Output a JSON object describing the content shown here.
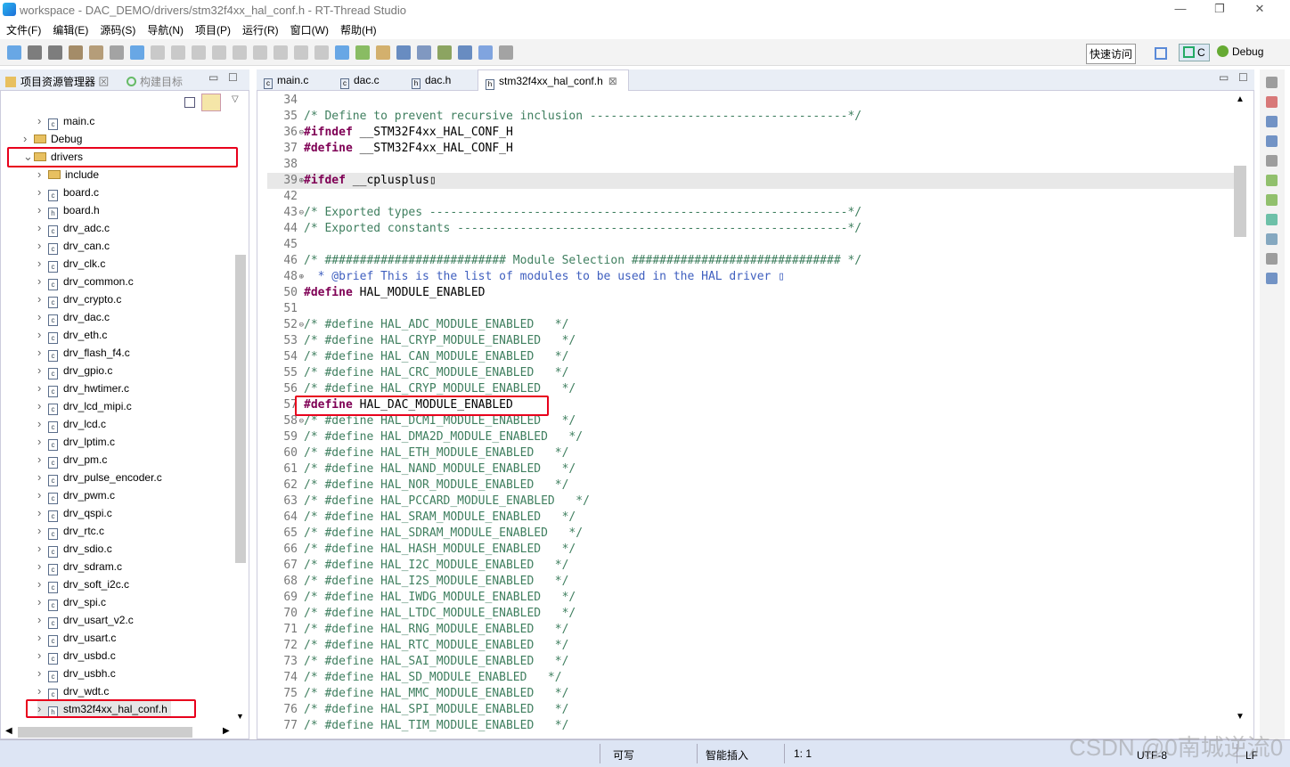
{
  "window": {
    "title": "workspace - DAC_DEMO/drivers/stm32f4xx_hal_conf.h - RT-Thread Studio",
    "min": "—",
    "max": "❐",
    "close": "✕"
  },
  "menu": [
    "文件(F)",
    "编辑(E)",
    "源码(S)",
    "导航(N)",
    "项目(P)",
    "运行(R)",
    "窗口(W)",
    "帮助(H)"
  ],
  "toolbar": {
    "quick_access": "快速访问",
    "perspective_c": "C",
    "perspective_debug": "Debug"
  },
  "left_tabs": [
    {
      "label": "项目资源管理器",
      "close": "⊠"
    },
    {
      "label": "构建目标"
    }
  ],
  "tree": [
    {
      "label": "main.c",
      "type": "c",
      "level": 2
    },
    {
      "label": "Debug",
      "type": "folder",
      "level": 1
    },
    {
      "label": "drivers",
      "type": "folder",
      "level": 1,
      "expanded": true,
      "highlighted": true
    },
    {
      "label": "include",
      "type": "folder",
      "level": 2
    },
    {
      "label": "board.c",
      "type": "c",
      "level": 2
    },
    {
      "label": "board.h",
      "type": "h",
      "level": 2
    },
    {
      "label": "drv_adc.c",
      "type": "c",
      "level": 2
    },
    {
      "label": "drv_can.c",
      "type": "c",
      "level": 2
    },
    {
      "label": "drv_clk.c",
      "type": "c",
      "level": 2
    },
    {
      "label": "drv_common.c",
      "type": "c",
      "level": 2
    },
    {
      "label": "drv_crypto.c",
      "type": "c",
      "level": 2
    },
    {
      "label": "drv_dac.c",
      "type": "c",
      "level": 2
    },
    {
      "label": "drv_eth.c",
      "type": "c",
      "level": 2
    },
    {
      "label": "drv_flash_f4.c",
      "type": "c",
      "level": 2
    },
    {
      "label": "drv_gpio.c",
      "type": "c",
      "level": 2
    },
    {
      "label": "drv_hwtimer.c",
      "type": "c",
      "level": 2
    },
    {
      "label": "drv_lcd_mipi.c",
      "type": "c",
      "level": 2
    },
    {
      "label": "drv_lcd.c",
      "type": "c",
      "level": 2
    },
    {
      "label": "drv_lptim.c",
      "type": "c",
      "level": 2
    },
    {
      "label": "drv_pm.c",
      "type": "c",
      "level": 2
    },
    {
      "label": "drv_pulse_encoder.c",
      "type": "c",
      "level": 2
    },
    {
      "label": "drv_pwm.c",
      "type": "c",
      "level": 2
    },
    {
      "label": "drv_qspi.c",
      "type": "c",
      "level": 2
    },
    {
      "label": "drv_rtc.c",
      "type": "c",
      "level": 2
    },
    {
      "label": "drv_sdio.c",
      "type": "c",
      "level": 2
    },
    {
      "label": "drv_sdram.c",
      "type": "c",
      "level": 2
    },
    {
      "label": "drv_soft_i2c.c",
      "type": "c",
      "level": 2
    },
    {
      "label": "drv_spi.c",
      "type": "c",
      "level": 2
    },
    {
      "label": "drv_usart_v2.c",
      "type": "c",
      "level": 2
    },
    {
      "label": "drv_usart.c",
      "type": "c",
      "level": 2
    },
    {
      "label": "drv_usbd.c",
      "type": "c",
      "level": 2
    },
    {
      "label": "drv_usbh.c",
      "type": "c",
      "level": 2
    },
    {
      "label": "drv_wdt.c",
      "type": "c",
      "level": 2
    },
    {
      "label": "stm32f4xx_hal_conf.h",
      "type": "h",
      "level": 2,
      "highlighted": true,
      "selected": true
    }
  ],
  "editor_tabs": [
    {
      "label": "main.c",
      "type": "c"
    },
    {
      "label": "dac.c",
      "type": "c"
    },
    {
      "label": "dac.h",
      "type": "h"
    },
    {
      "label": "stm32f4xx_hal_conf.h",
      "type": "h",
      "active": true,
      "close": "⊠"
    }
  ],
  "code": [
    {
      "n": "34",
      "c": "cm",
      "t": ""
    },
    {
      "n": "35",
      "c": "cm",
      "t": "/* Define to prevent recursive inclusion -------------------------------------*/"
    },
    {
      "n": "36",
      "fold": "⊖",
      "kw": "#ifndef",
      "t": " __STM32F4xx_HAL_CONF_H"
    },
    {
      "n": "37",
      "kw": "#define",
      "t": " __STM32F4xx_HAL_CONF_H"
    },
    {
      "n": "38",
      "t": ""
    },
    {
      "n": "39",
      "fold": "⊕",
      "kw": "#ifdef",
      "t": " __cplusplus▯",
      "hl": true
    },
    {
      "n": "42",
      "t": ""
    },
    {
      "n": "43",
      "fold": "⊖",
      "c": "cm",
      "t": "/* Exported types ------------------------------------------------------------*/"
    },
    {
      "n": "44",
      "c": "cm",
      "t": "/* Exported constants --------------------------------------------------------*/"
    },
    {
      "n": "45",
      "t": ""
    },
    {
      "n": "46",
      "c": "cm",
      "t": "/* ########################## Module Selection ############################## */"
    },
    {
      "n": "48",
      "fold": "⊕",
      "c": "doc",
      "t": "  * @brief This is the list of modules to be used in the HAL driver ▯"
    },
    {
      "n": "50",
      "kw": "#define",
      "t": " HAL_MODULE_ENABLED"
    },
    {
      "n": "51",
      "t": ""
    },
    {
      "n": "52",
      "fold": "⊖",
      "c": "cm",
      "t": "/* #define HAL_ADC_MODULE_ENABLED   */"
    },
    {
      "n": "53",
      "c": "cm",
      "t": "/* #define HAL_CRYP_MODULE_ENABLED   */"
    },
    {
      "n": "54",
      "c": "cm",
      "t": "/* #define HAL_CAN_MODULE_ENABLED   */"
    },
    {
      "n": "55",
      "c": "cm",
      "t": "/* #define HAL_CRC_MODULE_ENABLED   */"
    },
    {
      "n": "56",
      "c": "cm",
      "t": "/* #define HAL_CRYP_MODULE_ENABLED   */"
    },
    {
      "n": "57",
      "kw": "#define",
      "t": " HAL_DAC_MODULE_ENABLED",
      "box": true
    },
    {
      "n": "58",
      "fold": "⊖",
      "c": "cm",
      "t": "/* #define HAL_DCMI_MODULE_ENABLED   */"
    },
    {
      "n": "59",
      "c": "cm",
      "t": "/* #define HAL_DMA2D_MODULE_ENABLED   */"
    },
    {
      "n": "60",
      "c": "cm",
      "t": "/* #define HAL_ETH_MODULE_ENABLED   */"
    },
    {
      "n": "61",
      "c": "cm",
      "t": "/* #define HAL_NAND_MODULE_ENABLED   */"
    },
    {
      "n": "62",
      "c": "cm",
      "t": "/* #define HAL_NOR_MODULE_ENABLED   */"
    },
    {
      "n": "63",
      "c": "cm",
      "t": "/* #define HAL_PCCARD_MODULE_ENABLED   */"
    },
    {
      "n": "64",
      "c": "cm",
      "t": "/* #define HAL_SRAM_MODULE_ENABLED   */"
    },
    {
      "n": "65",
      "c": "cm",
      "t": "/* #define HAL_SDRAM_MODULE_ENABLED   */"
    },
    {
      "n": "66",
      "c": "cm",
      "t": "/* #define HAL_HASH_MODULE_ENABLED   */"
    },
    {
      "n": "67",
      "c": "cm",
      "t": "/* #define HAL_I2C_MODULE_ENABLED   */"
    },
    {
      "n": "68",
      "c": "cm",
      "t": "/* #define HAL_I2S_MODULE_ENABLED   */"
    },
    {
      "n": "69",
      "c": "cm",
      "t": "/* #define HAL_IWDG_MODULE_ENABLED   */"
    },
    {
      "n": "70",
      "c": "cm",
      "t": "/* #define HAL_LTDC_MODULE_ENABLED   */"
    },
    {
      "n": "71",
      "c": "cm",
      "t": "/* #define HAL_RNG_MODULE_ENABLED   */"
    },
    {
      "n": "72",
      "c": "cm",
      "t": "/* #define HAL_RTC_MODULE_ENABLED   */"
    },
    {
      "n": "73",
      "c": "cm",
      "t": "/* #define HAL_SAI_MODULE_ENABLED   */"
    },
    {
      "n": "74",
      "c": "cm",
      "t": "/* #define HAL_SD_MODULE_ENABLED   */"
    },
    {
      "n": "75",
      "c": "cm",
      "t": "/* #define HAL_MMC_MODULE_ENABLED   */"
    },
    {
      "n": "76",
      "c": "cm",
      "t": "/* #define HAL_SPI_MODULE_ENABLED   */"
    },
    {
      "n": "77",
      "c": "cm",
      "t": "/* #define HAL_TIM_MODULE_ENABLED   */"
    }
  ],
  "status": {
    "writable": "可写",
    "insert_mode": "智能插入",
    "position": "1: 1",
    "encoding": "UTF-8",
    "line_ending": "LF"
  },
  "watermark": "CSDN @0南城逆流0",
  "colors": {
    "highlight_box": "#e8001c",
    "keyword": "#7f0055",
    "comment": "#3f7f5f",
    "doc": "#3f5fbf"
  }
}
